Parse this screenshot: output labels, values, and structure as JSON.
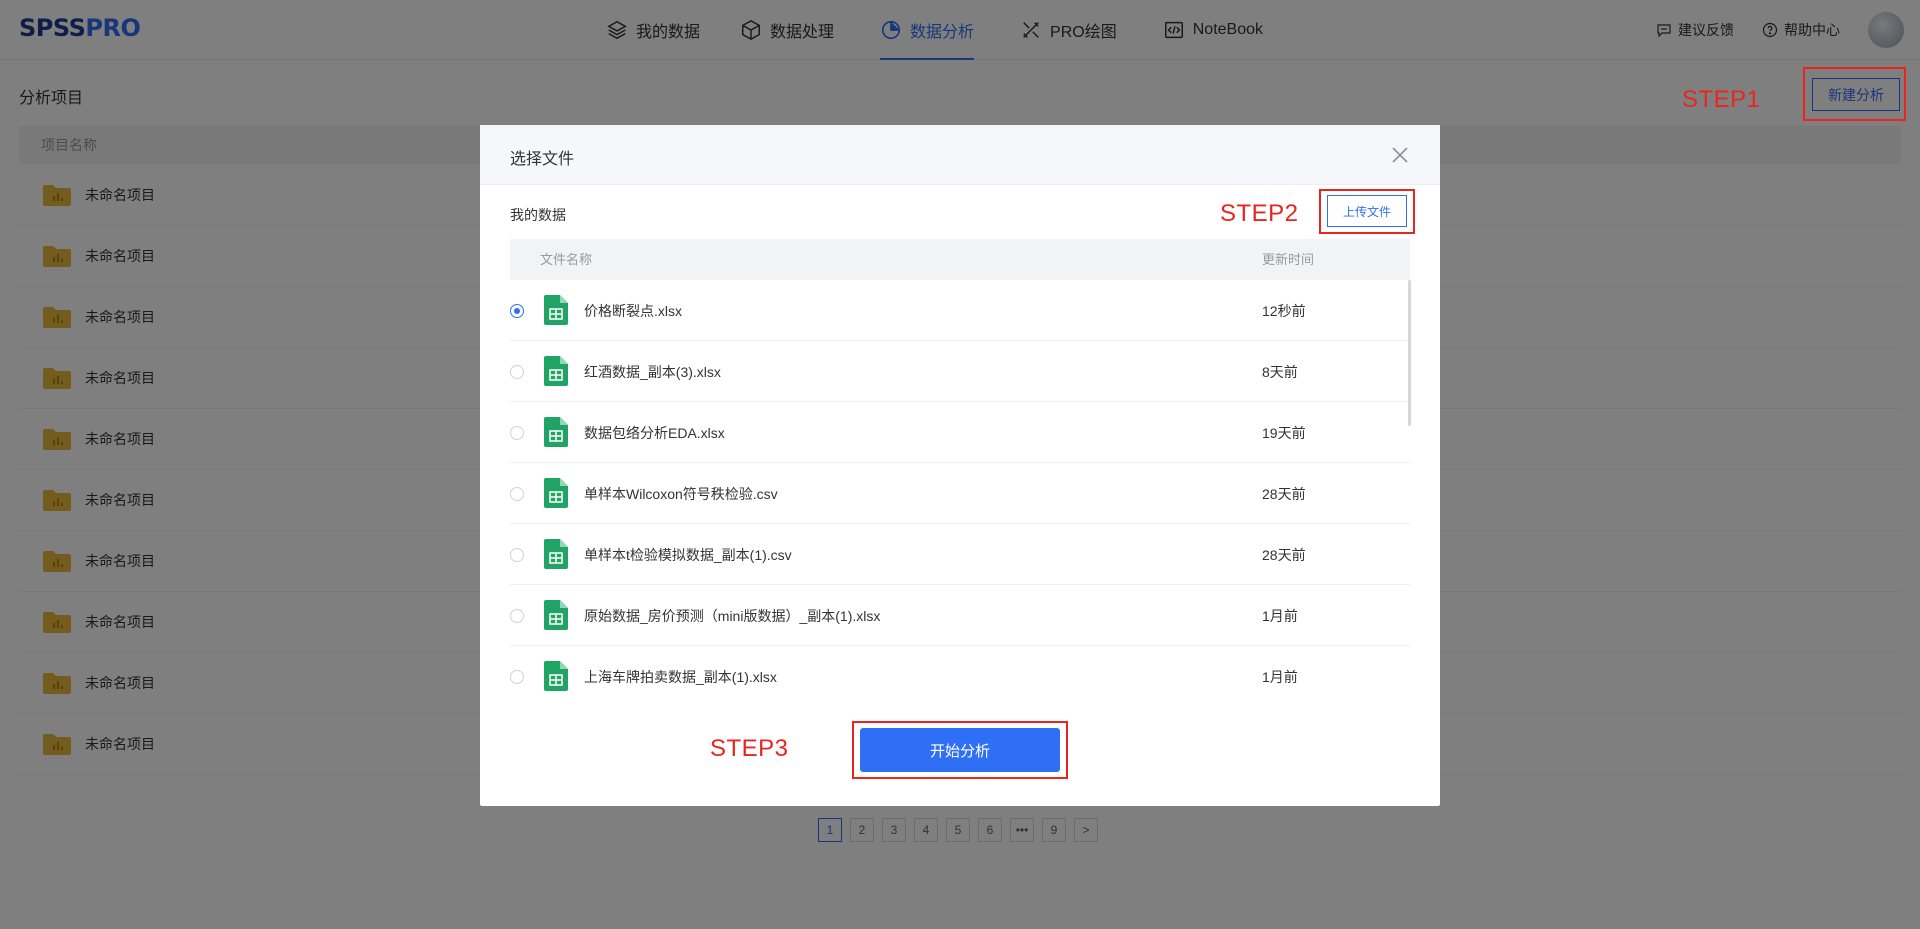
{
  "header": {
    "logo_left": "SPSS",
    "logo_right": "PRO",
    "nav": [
      {
        "label": "我的数据",
        "icon": "layers-icon",
        "active": false
      },
      {
        "label": "数据处理",
        "icon": "cube-icon",
        "active": false
      },
      {
        "label": "数据分析",
        "icon": "pie-chart-icon",
        "active": true
      },
      {
        "label": "PRO绘图",
        "icon": "draw-tools-icon",
        "active": false
      },
      {
        "label": "NoteBook",
        "icon": "code-icon",
        "active": false
      }
    ],
    "feedback_label": "建议反馈",
    "help_label": "帮助中心"
  },
  "page": {
    "title": "分析项目",
    "new_button": "新建分析",
    "table_header": "项目名称",
    "projects": [
      "未命名项目",
      "未命名项目",
      "未命名项目",
      "未命名项目",
      "未命名项目",
      "未命名项目",
      "未命名项目",
      "未命名项目",
      "未命名项目",
      "未命名项目"
    ],
    "pagination": [
      "1",
      "2",
      "3",
      "4",
      "5",
      "6",
      "•••",
      "9",
      ">"
    ],
    "current_page": "1"
  },
  "modal": {
    "title": "选择文件",
    "section_label": "我的数据",
    "upload_button": "上传文件",
    "col_name": "文件名称",
    "col_time": "更新时间",
    "files": [
      {
        "name": "价格断裂点.xlsx",
        "time": "12秒前",
        "selected": true
      },
      {
        "name": "红酒数据_副本(3).xlsx",
        "time": "8天前",
        "selected": false
      },
      {
        "name": "数据包络分析EDA.xlsx",
        "time": "19天前",
        "selected": false
      },
      {
        "name": "单样本Wilcoxon符号秩检验.csv",
        "time": "28天前",
        "selected": false
      },
      {
        "name": "单样本t检验模拟数据_副本(1).csv",
        "time": "28天前",
        "selected": false
      },
      {
        "name": "原始数据_房价预测（mini版数据）_副本(1).xlsx",
        "time": "1月前",
        "selected": false
      },
      {
        "name": "上海车牌拍卖数据_副本(1).xlsx",
        "time": "1月前",
        "selected": false
      }
    ],
    "start_button": "开始分析"
  },
  "annotations": {
    "step1": "STEP1",
    "step2": "STEP2",
    "step3": "STEP3"
  },
  "colors": {
    "accent": "#2f6ff5",
    "annotation": "#e8261f",
    "folder": "#e8b93c",
    "xls": "#21a366"
  }
}
